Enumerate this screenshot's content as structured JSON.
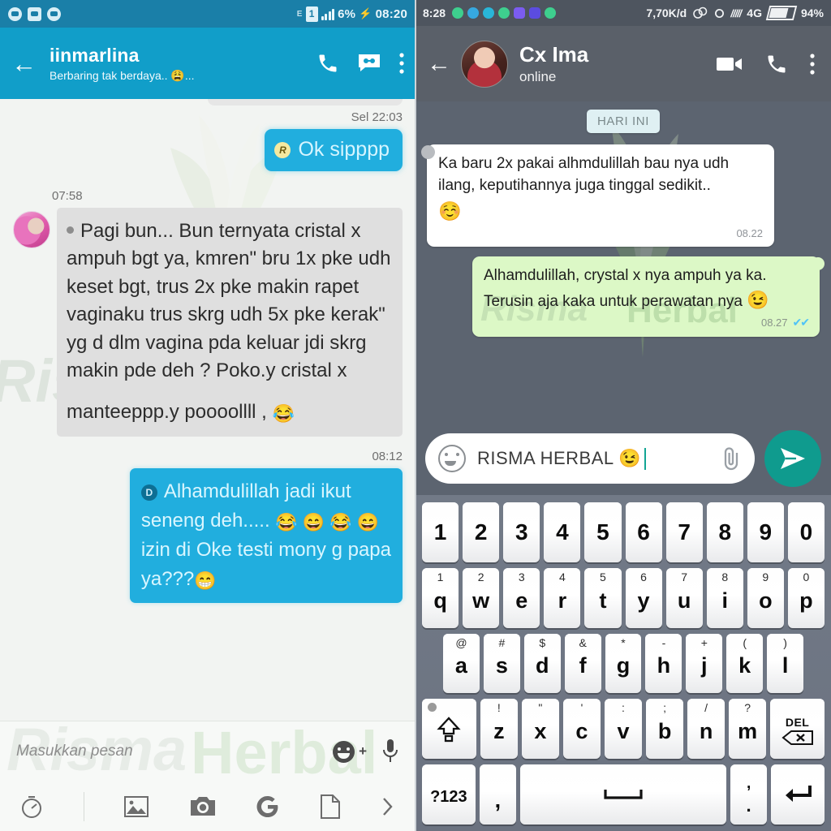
{
  "left_panel": {
    "status_bar": {
      "time": "08:20",
      "battery_percent": "6%",
      "network_type": "E",
      "sim_label": "1",
      "icons": [
        "whatsapp-icon",
        "bbm-icon",
        "line-icon",
        "edge-network-icon",
        "sim-icon",
        "signal-bars-icon",
        "charging-bolt-icon"
      ]
    },
    "header": {
      "back_icon": "back-arrow-icon",
      "contact_name": "iinmarlina",
      "status_text": "Berbaring tak berdaya.. 😩...",
      "actions": [
        "phone-icon",
        "chat-bot-icon",
        "overflow-menu-icon"
      ]
    },
    "messages": [
      {
        "id": "msg-ok-sipppp",
        "direction": "outgoing",
        "timestamp": "Sel 22:03",
        "badge": "R",
        "text": "Ok sipppp"
      },
      {
        "id": "msg-pagi-bun",
        "direction": "incoming",
        "timestamp": "07:58",
        "avatar": "contact-avatar",
        "text_block_1": "Pagi bun... Bun ternyata cristal x ampuh bgt ya, kmren\" bru 1x pke udh keset bgt, trus 2x pke makin rapet vaginaku trus skrg udh 5x pke kerak\" yg d dlm vagina pda keluar jdi skrg makin pde deh ? Poko.y cristal x",
        "text_block_2": "manteeppp.y poooollll ,",
        "emoji": "😂"
      },
      {
        "id": "msg-alhamdulillah-jadi-ikut",
        "direction": "outgoing",
        "timestamp": "08:12",
        "badge": "D",
        "line_1": "Alhamdulillah jadi ikut",
        "line_2": "seneng deh.....",
        "line_2_emojis": "😂 😄 😂 😄",
        "line_3": "izin di Oke testi mony g papa",
        "line_4": "ya???",
        "line_4_emoji": "😁"
      }
    ],
    "composer": {
      "placeholder": "Masukkan pesan",
      "emoji_icon": "emoji-smiley-icon",
      "plus_icon": "plus-icon",
      "mic_icon": "microphone-icon",
      "tools": [
        "timer-icon",
        "gallery-icon",
        "camera-icon",
        "google-icon",
        "document-icon",
        "more-chevron-icon"
      ]
    }
  },
  "right_panel": {
    "status_bar": {
      "time": "8:28",
      "data_rate": "7,70K/d",
      "network_type": "4G",
      "battery_percent": "94%",
      "icons": [
        "whatsapp-icon",
        "app-icon-blue",
        "app-icon-teal",
        "whatsapp-icon-2",
        "facebook-icon",
        "facebook-icon-2",
        "whatsapp-icon-3",
        "sync-icon",
        "dnd-icon",
        "signal-icon",
        "battery-icon"
      ]
    },
    "header": {
      "back_icon": "back-arrow-icon",
      "avatar": "contact-avatar",
      "contact_name": "Cx Ima",
      "status_text": "online",
      "actions": [
        "video-call-icon",
        "voice-call-icon",
        "overflow-menu-icon"
      ]
    },
    "day_divider": "HARI INI",
    "messages": [
      {
        "id": "msg-ka-baru-2x",
        "direction": "incoming",
        "line_1": "Ka baru 2x pakai alhmdulillah bau nya udh",
        "line_2": "ilang, keputihannya juga tinggal sedikit..",
        "emoji": "☺️",
        "timestamp": "08.22"
      },
      {
        "id": "msg-alhamdulillah-crystal",
        "direction": "outgoing",
        "line_1": "Alhamdulillah, crystal x nya ampuh ya ka.",
        "line_2": "Terusin aja kaka untuk perawatan nya",
        "emoji": "😉",
        "timestamp": "08.27",
        "status_ticks": "read"
      }
    ],
    "composer": {
      "emoji_icon": "emoji-smiley-icon",
      "value": "RISMA HERBAL 😉",
      "attach_icon": "paperclip-icon",
      "send_icon": "send-icon"
    },
    "keyboard": {
      "row_numbers": [
        {
          "main": "1"
        },
        {
          "main": "2"
        },
        {
          "main": "3"
        },
        {
          "main": "4"
        },
        {
          "main": "5"
        },
        {
          "main": "6"
        },
        {
          "main": "7"
        },
        {
          "main": "8"
        },
        {
          "main": "9"
        },
        {
          "main": "0"
        }
      ],
      "row_qwerty": [
        {
          "alt": "1",
          "main": "q"
        },
        {
          "alt": "2",
          "main": "w"
        },
        {
          "alt": "3",
          "main": "e"
        },
        {
          "alt": "4",
          "main": "r"
        },
        {
          "alt": "5",
          "main": "t"
        },
        {
          "alt": "6",
          "main": "y"
        },
        {
          "alt": "7",
          "main": "u"
        },
        {
          "alt": "8",
          "main": "i"
        },
        {
          "alt": "9",
          "main": "o"
        },
        {
          "alt": "0",
          "main": "p"
        }
      ],
      "row_asdf": [
        {
          "alt": "@",
          "main": "a"
        },
        {
          "alt": "#",
          "main": "s"
        },
        {
          "alt": "$",
          "main": "d"
        },
        {
          "alt": "&",
          "main": "f"
        },
        {
          "alt": "*",
          "main": "g"
        },
        {
          "alt": "-",
          "main": "h"
        },
        {
          "alt": "+",
          "main": "j"
        },
        {
          "alt": "(",
          "main": "k"
        },
        {
          "alt": ")",
          "main": "l"
        }
      ],
      "row_zxcv": [
        {
          "alt": "!",
          "main": "z"
        },
        {
          "alt": "\"",
          "main": "x"
        },
        {
          "alt": "'",
          "main": "c"
        },
        {
          "alt": ":",
          "main": "v"
        },
        {
          "alt": ";",
          "main": "b"
        },
        {
          "alt": "/",
          "main": "n"
        },
        {
          "alt": "?",
          "main": "m"
        }
      ],
      "shift_key": "shift-icon",
      "delete_key_label": "DEL",
      "delete_key_icon": "backspace-icon",
      "symbols_key": "?123",
      "comma_key": ",",
      "space_key": "space-icon",
      "period_key_top": ",",
      "period_key_bottom": ".",
      "enter_key": "enter-icon"
    }
  },
  "watermark": {
    "text_left": "Risma",
    "text_right": "Herbal"
  },
  "colors": {
    "left_header": "#119ec9",
    "left_status": "#1a7fa8",
    "left_bubble_out": "#21aede",
    "left_bubble_in": "#dfdfdf",
    "right_header": "#5a6069",
    "right_chat_bg": "#5c6470",
    "right_bubble_out": "#dcf8c6",
    "right_bubble_in": "#ffffff",
    "send_button": "#0f9b8e",
    "keyboard_bg": "#6f7784"
  }
}
